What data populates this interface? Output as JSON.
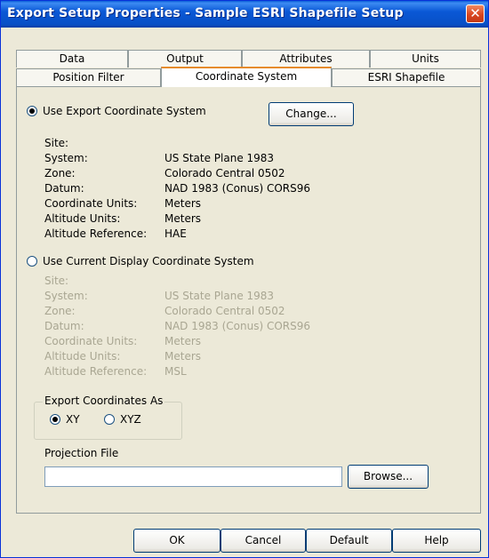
{
  "window": {
    "title": "Export Setup Properties - Sample ESRI Shapefile Setup",
    "close_glyph": "✕"
  },
  "tabs": {
    "row1": [
      "Data",
      "Output",
      "Attributes",
      "Units"
    ],
    "row2": [
      "Position Filter",
      "Coordinate System",
      "ESRI Shapefile"
    ],
    "selected": "Coordinate System"
  },
  "export_system": {
    "radio_label": "Use Export Coordinate System",
    "selected": true,
    "change_label": "Change...",
    "fields": [
      {
        "key": "Site:",
        "value": ""
      },
      {
        "key": "System:",
        "value": "US State Plane 1983"
      },
      {
        "key": "Zone:",
        "value": "Colorado Central 0502"
      },
      {
        "key": "Datum:",
        "value": "NAD 1983 (Conus) CORS96"
      },
      {
        "key": "Coordinate Units:",
        "value": "Meters"
      },
      {
        "key": "Altitude Units:",
        "value": "Meters"
      },
      {
        "key": "Altitude Reference:",
        "value": "HAE"
      }
    ]
  },
  "display_system": {
    "radio_label": "Use Current Display Coordinate System",
    "selected": false,
    "fields": [
      {
        "key": "Site:",
        "value": ""
      },
      {
        "key": "System:",
        "value": "US State Plane 1983"
      },
      {
        "key": "Zone:",
        "value": "Colorado Central 0502"
      },
      {
        "key": "Datum:",
        "value": "NAD 1983 (Conus) CORS96"
      },
      {
        "key": "Coordinate Units:",
        "value": "Meters"
      },
      {
        "key": "Altitude Units:",
        "value": "Meters"
      },
      {
        "key": "Altitude Reference:",
        "value": "MSL"
      }
    ]
  },
  "export_as": {
    "group_label": "Export Coordinates As",
    "xy_label": "XY",
    "xyz_label": "XYZ",
    "selected": "XY"
  },
  "projection": {
    "label": "Projection File",
    "value": "",
    "browse_label": "Browse..."
  },
  "footer": {
    "ok_label": "OK",
    "cancel_label": "Cancel",
    "default_label": "Default",
    "help_label": "Help"
  },
  "colors": {
    "titlebar": "#0a58d6",
    "dialog_bg": "#ece9d8",
    "disabled_text": "#a9a692",
    "selected_tab_accent": "#e68b2c"
  }
}
